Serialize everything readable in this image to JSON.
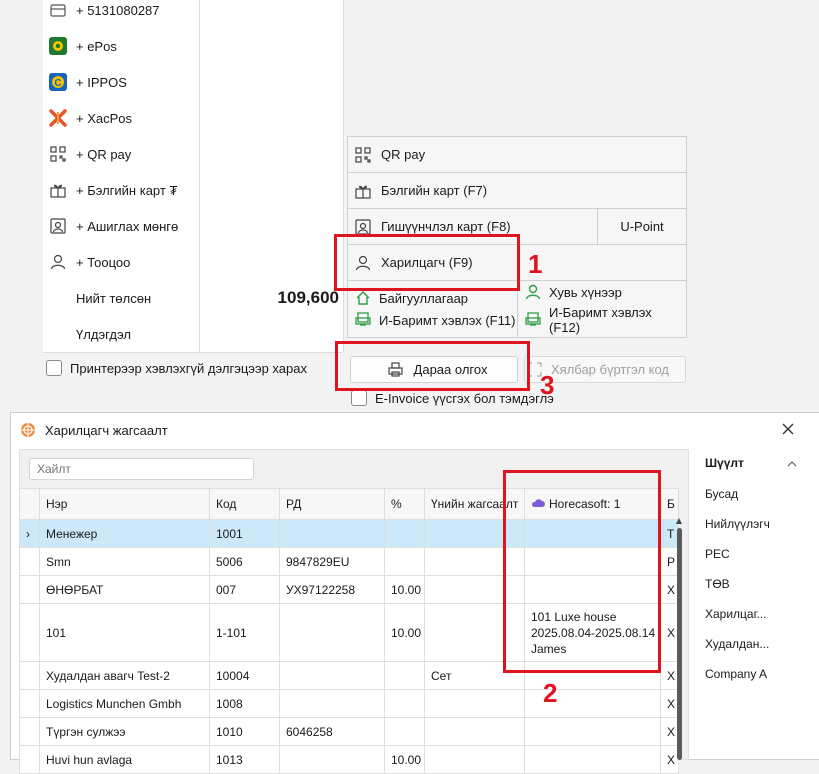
{
  "payments": [
    {
      "label": "+ 5131080287",
      "icon": "card-icon",
      "value": ""
    },
    {
      "label": "+ ePos",
      "icon": "epos-icon",
      "value": ""
    },
    {
      "label": "+ IPPOS",
      "icon": "ippos-icon",
      "value": ""
    },
    {
      "label": "+ XacPos",
      "icon": "xacpos-icon",
      "value": ""
    },
    {
      "label": "+ QR pay",
      "icon": "qr-icon",
      "value": ""
    },
    {
      "label": "+ Бэлгийн карт ₮",
      "icon": "gift-card-icon",
      "value": ""
    },
    {
      "label": "+ Ашиглах мөнгө",
      "icon": "wallet-icon",
      "value": ""
    },
    {
      "label": "+ Тооцоо",
      "icon": "person-icon",
      "value": ""
    },
    {
      "label": "Нийт төлсөн",
      "icon": "",
      "value": "109,600"
    },
    {
      "label": "Үлдэгдэл",
      "icon": "",
      "value": ""
    }
  ],
  "print_preview_checkbox": "Принтерээр хэвлэхгүй дэлгэцээр харах",
  "right_buttons": {
    "qr_pay": "QR pay",
    "gift_card": "Бэлгийн карт (F7)",
    "membership_card": "Гишүүнчлэл карт (F8)",
    "upoint": "U-Point",
    "customer": "Харилцагч (F9)",
    "organization": "Байгууллагаар",
    "org_ebarimt": "И-Баримт хэвлэх (F11)",
    "personal": "Хувь хүнээр",
    "personal_ebarimt": "И-Баримт хэвлэх (F12)",
    "pay_later": "Дараа олгох",
    "easy_register": "Хялбар бүртгэл код",
    "einvoice": "E-Invoice үүсгэх бол тэмдэглэ"
  },
  "annotations": [
    "1",
    "2",
    "3"
  ],
  "dialog": {
    "title": "Харилцагч жагсаалт",
    "search_placeholder": "Хайлт",
    "columns": [
      "Нэр",
      "Код",
      "РД",
      "%",
      "Үнийн жагсаалт",
      "Horecasoft: 1",
      "Б"
    ],
    "rows": [
      {
        "name": "Менежер",
        "code": "1001",
        "rd": "",
        "pct": "",
        "price": "",
        "horeca": "",
        "b": "Т"
      },
      {
        "name": "Smn",
        "code": "5006",
        "rd": "9847829EU",
        "pct": "",
        "price": "",
        "horeca": "",
        "b": "Р"
      },
      {
        "name": "ӨНӨРБАТ",
        "code": "007",
        "rd": "УХ97122258",
        "pct": "10.00",
        "price": "",
        "horeca": "",
        "b": "Х"
      },
      {
        "name": "101",
        "code": "1-101",
        "rd": "",
        "pct": "10.00",
        "price": "",
        "horeca": "101 Luxe house\n2025.08.04-2025.08.14\nJames",
        "b": "Х"
      },
      {
        "name": "Худалдан авагч Test-2",
        "code": "10004",
        "rd": "",
        "pct": "",
        "price": "Сет",
        "horeca": "",
        "b": "Х"
      },
      {
        "name": "Logistics Munchen Gmbh",
        "code": "1008",
        "rd": "",
        "pct": "",
        "price": "",
        "horeca": "",
        "b": "Х"
      },
      {
        "name": "Түргэн сулжээ",
        "code": "1010",
        "rd": "6046258",
        "pct": "",
        "price": "",
        "horeca": "",
        "b": "Х"
      },
      {
        "name": "Huvi hun avlaga",
        "code": "1013",
        "rd": "",
        "pct": "10.00",
        "price": "",
        "horeca": "",
        "b": "Х"
      }
    ],
    "filter_title": "Шүүлт",
    "filters": [
      "Бусад",
      "Нийлүүлэгч",
      "PEC",
      "ТӨВ",
      "Харилцаг...",
      "Худалдан...",
      "Company A"
    ]
  },
  "colors": {
    "annotation_red": "#e0141e",
    "selected_row": "#cde8f8",
    "green_icon": "#2e9e45"
  }
}
